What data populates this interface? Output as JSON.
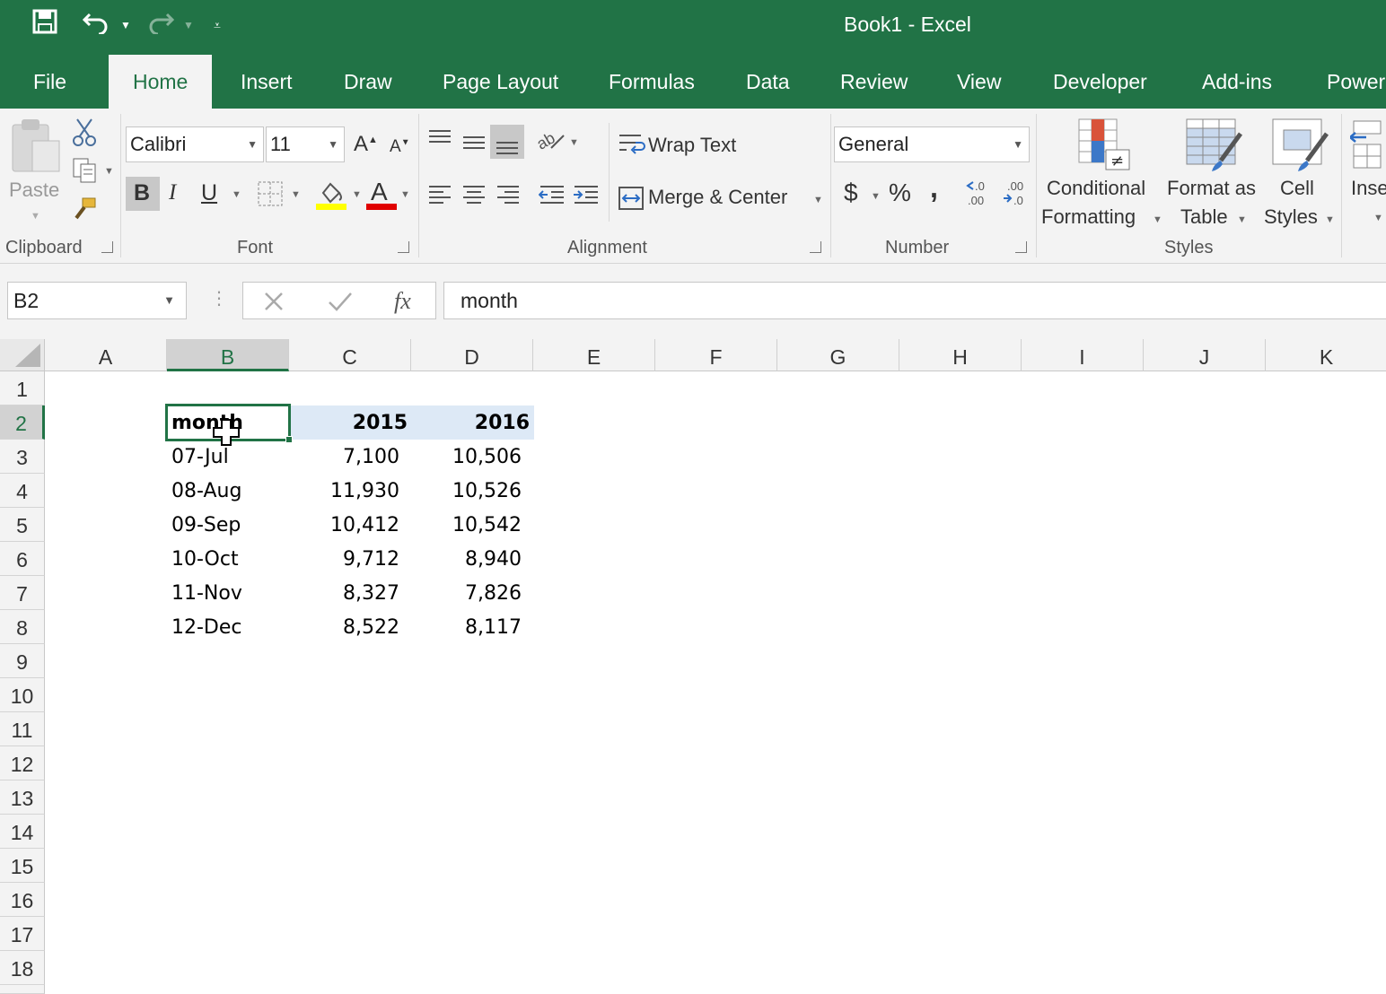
{
  "window": {
    "title": "Book1  -  Excel"
  },
  "tabs": [
    "File",
    "Home",
    "Insert",
    "Draw",
    "Page Layout",
    "Formulas",
    "Data",
    "Review",
    "View",
    "Developer",
    "Add-ins",
    "Power"
  ],
  "active_tab": "Home",
  "ribbon": {
    "clipboard": {
      "paste_label": "Paste",
      "group_label": "Clipboard"
    },
    "font": {
      "font_name": "Calibri",
      "font_size": "11",
      "bold": "B",
      "italic": "I",
      "underline": "U",
      "group_label": "Font"
    },
    "alignment": {
      "wrap_text": "Wrap Text",
      "merge_center": "Merge & Center",
      "group_label": "Alignment"
    },
    "number": {
      "format": "General",
      "currency": "$",
      "percent": "%",
      "comma": ",",
      "group_label": "Number"
    },
    "styles": {
      "conditional_1": "Conditional",
      "conditional_2": "Formatting",
      "format_as_1": "Format as",
      "format_as_2": "Table",
      "cell_styles_1": "Cell",
      "cell_styles_2": "Styles",
      "group_label": "Styles"
    },
    "cells": {
      "insert_partial": "Inse"
    }
  },
  "formula_bar": {
    "name_box": "B2",
    "fx": "fx",
    "formula": "month"
  },
  "grid": {
    "columns": [
      "A",
      "B",
      "C",
      "D",
      "E",
      "F",
      "G",
      "H",
      "I",
      "J",
      "K"
    ],
    "rows": [
      "1",
      "2",
      "3",
      "4",
      "5",
      "6",
      "7",
      "8",
      "9",
      "10",
      "11",
      "12",
      "13",
      "14",
      "15",
      "16",
      "17",
      "18"
    ],
    "selected_cell": "B2",
    "table": {
      "headers": [
        "month",
        "2015",
        "2016"
      ],
      "rows": [
        [
          "07-Jul",
          "7,100",
          "10,506"
        ],
        [
          "08-Aug",
          "11,930",
          "10,526"
        ],
        [
          "09-Sep",
          "10,412",
          "10,542"
        ],
        [
          "10-Oct",
          "9,712",
          "8,940"
        ],
        [
          "11-Nov",
          "8,327",
          "7,826"
        ],
        [
          "12-Dec",
          "8,522",
          "8,117"
        ]
      ]
    }
  },
  "colors": {
    "excel_green": "#217346",
    "highlight_fill": "#FFFF00",
    "font_color": "#E00000",
    "header_band": "#DDE9F6"
  }
}
